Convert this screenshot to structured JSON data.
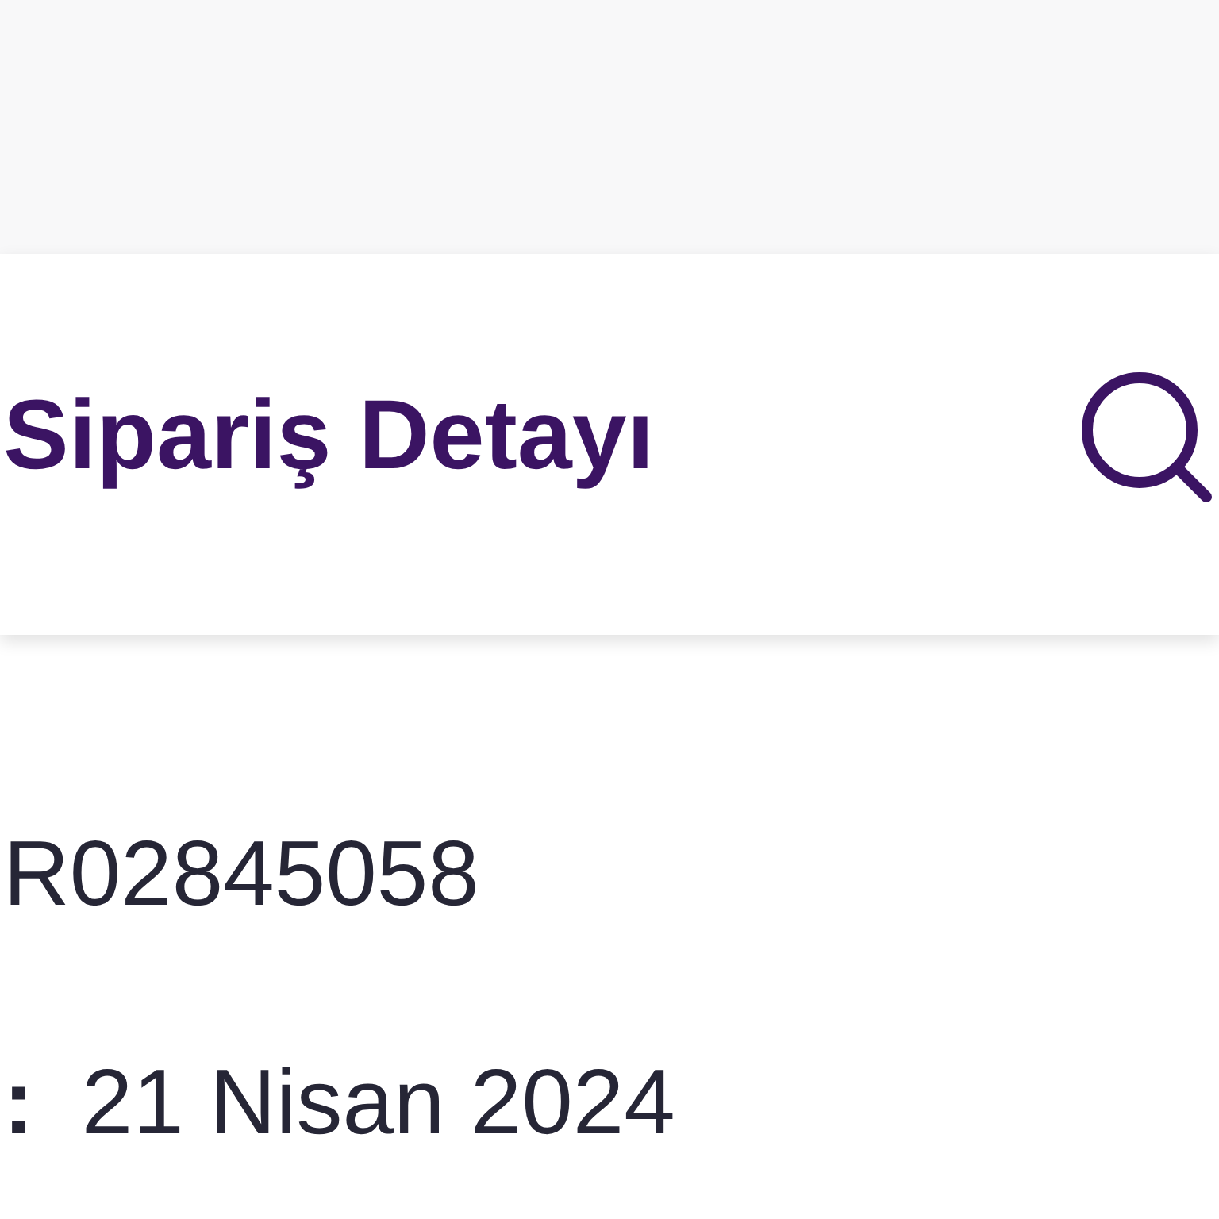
{
  "header": {
    "title": "Sipariş Detayı"
  },
  "order": {
    "number": "R02845058",
    "date_label": ":",
    "date": "21 Nisan 2024"
  }
}
